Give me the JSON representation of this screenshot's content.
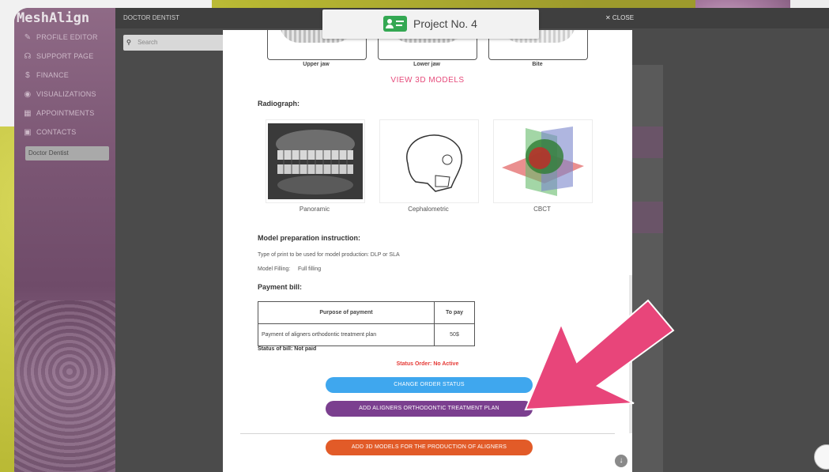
{
  "app": {
    "logo": "MeshAlign",
    "header_title": "DOCTOR DENTIST",
    "close_label": "✕ CLOSE",
    "search_placeholder": "Search"
  },
  "sidebar": {
    "items": [
      {
        "icon": "pencil-icon",
        "label": "PROFILE EDITOR"
      },
      {
        "icon": "headset-icon",
        "label": "SUPPORT PAGE"
      },
      {
        "icon": "dollar-icon",
        "label": "FINANCE"
      },
      {
        "icon": "eye-icon",
        "label": "VISUALIZATIONS"
      },
      {
        "icon": "calendar-icon",
        "label": "APPOINTMENTS"
      },
      {
        "icon": "contacts-icon",
        "label": "CONTACTS"
      }
    ],
    "user_name": "Doctor Dentist"
  },
  "modal": {
    "project_title": "Project No. 4",
    "models": [
      {
        "label": "Upper jaw"
      },
      {
        "label": "Lower jaw"
      },
      {
        "label": "Bite"
      }
    ],
    "view_models_link": "VIEW 3D MODELS",
    "radiograph_title": "Radiograph:",
    "radiographs": [
      {
        "label": "Panoramic"
      },
      {
        "label": "Cephalometric"
      },
      {
        "label": "CBCT"
      }
    ],
    "prep_title": "Model preparation instruction:",
    "prep_lines": [
      "Type of print to be used for model production: DLP or SLA",
      "Model Filling:     Full filling"
    ],
    "payment_title": "Payment bill:",
    "bill_headers": [
      "Purpose of payment",
      "To pay"
    ],
    "bill_rows": [
      {
        "purpose": "Payment of aligners orthodontic treatment plan",
        "amount": "50$"
      }
    ],
    "status_bill": "Status of bill: Not paid",
    "status_order": "Status Order: No Active",
    "buttons": {
      "change_status": "CHANGE ORDER STATUS",
      "add_plan": "ADD ALIGNERS ORTHODONTIC TREATMENT PLAN",
      "add_models": "ADD 3D MODELS FOR THE PRODUCTION OF ALIGNERS"
    }
  },
  "colors": {
    "accent_pink": "#e64a7a",
    "button_blue": "#3fa7ee",
    "button_purple": "#7b3f8f",
    "button_orange": "#e25b28",
    "status_red": "#e53935",
    "arrow": "#e8457a"
  }
}
